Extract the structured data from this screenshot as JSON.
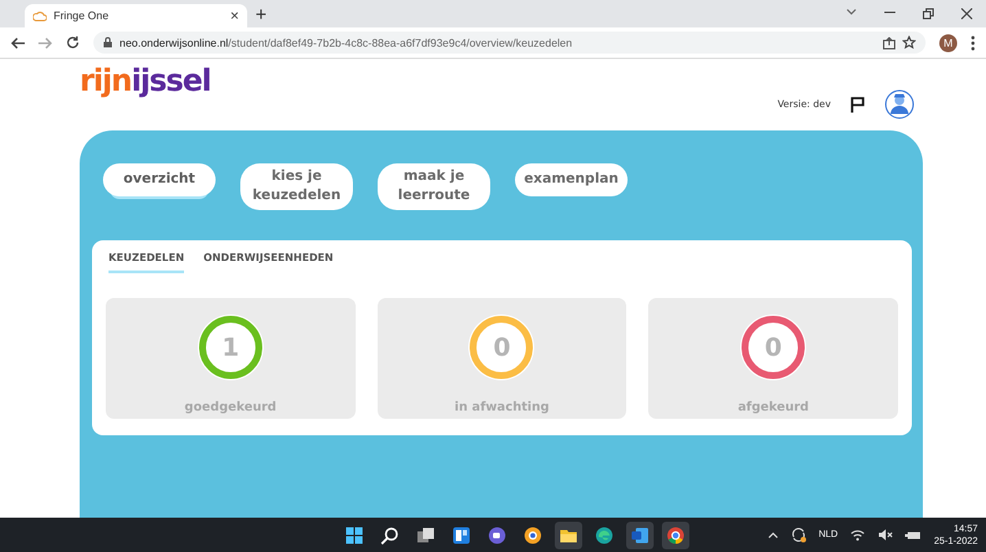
{
  "browser": {
    "tab": {
      "title": "Fringe One",
      "close": "×"
    },
    "new_tab": "+",
    "url_host": "neo.onderwijsonline.nl",
    "url_path": "/student/daf8ef49-7b2b-4c8c-88ea-a6f7df93e9c4/overview/keuzedelen",
    "profile": "M"
  },
  "header": {
    "logo": {
      "part_1": "rijn",
      "part_2": "ijssel"
    },
    "version": "Versie: dev"
  },
  "nav": [
    {
      "label": "overzicht",
      "selected": true
    },
    {
      "label": "kies je keuzedelen",
      "selected": false
    },
    {
      "label": "maak je leerroute",
      "selected": false
    },
    {
      "label": "examenplan",
      "selected": false
    }
  ],
  "subtabs": [
    {
      "label": "KEUZEDELEN",
      "selected": true
    },
    {
      "label": "ONDERWIJSEENHEDEN",
      "selected": false
    }
  ],
  "status_cards": [
    {
      "count": "1",
      "label": "goedgekeurd",
      "color": "#6abf1f"
    },
    {
      "count": "0",
      "label": "in afwachting",
      "color": "#fbbd45"
    },
    {
      "count": "0",
      "label": "afgekeurd",
      "color": "#e85a72"
    }
  ],
  "taskbar": {
    "language": "NLD",
    "time": "14:57",
    "date": "25-1-2022"
  }
}
